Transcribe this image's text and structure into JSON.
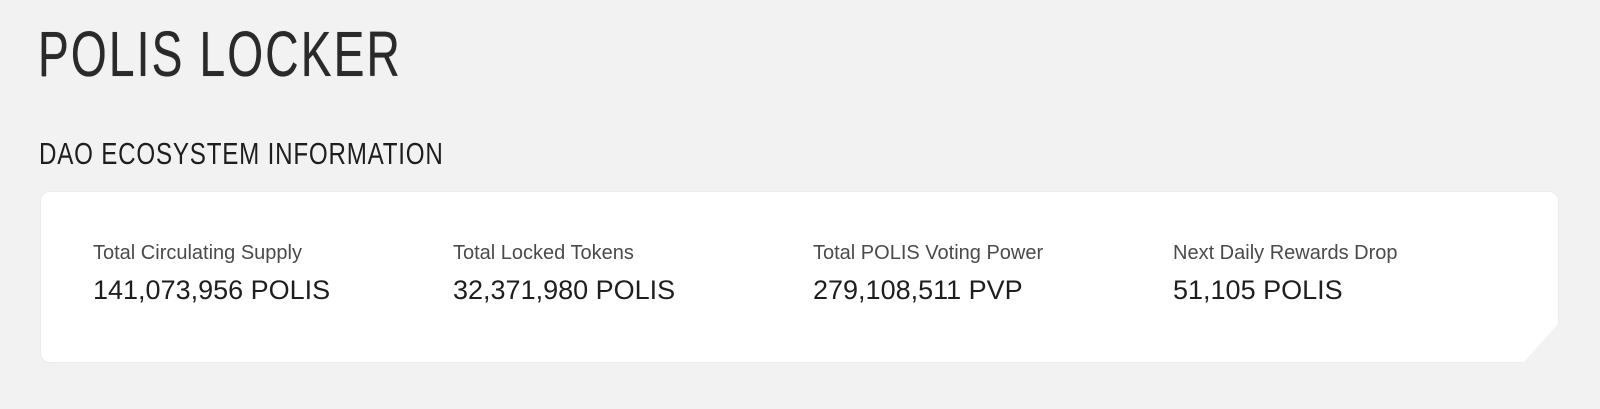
{
  "page": {
    "title": "POLIS LOCKER"
  },
  "section": {
    "title": "DAO ECOSYSTEM INFORMATION"
  },
  "stats": [
    {
      "label": "Total Circulating Supply",
      "value": "141,073,956 POLIS"
    },
    {
      "label": "Total Locked Tokens",
      "value": "32,371,980 POLIS"
    },
    {
      "label": "Total POLIS Voting Power",
      "value": "279,108,511 PVP"
    },
    {
      "label": "Next Daily Rewards Drop",
      "value": "51,105 POLIS"
    }
  ],
  "colors": {
    "background": "#f2f2f2",
    "card": "#ffffff",
    "text": "#1e1e1e",
    "label": "#4a4a4a"
  }
}
